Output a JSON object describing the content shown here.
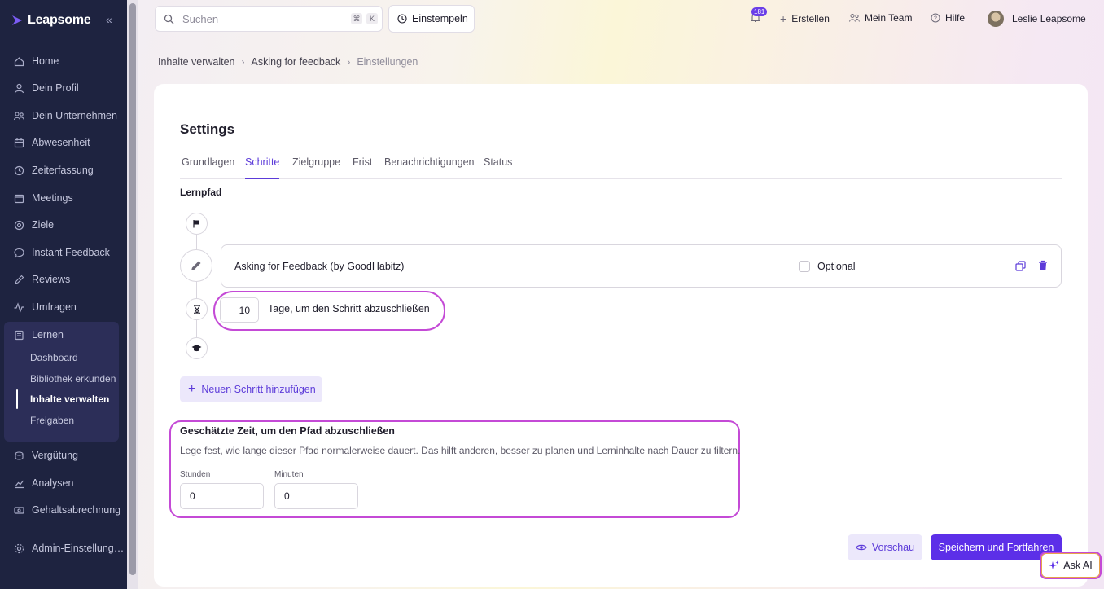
{
  "app": {
    "brand": "Leapsome",
    "collapse_glyph": "«"
  },
  "sidebar": {
    "items": [
      {
        "label": "Home",
        "icon": "home-icon"
      },
      {
        "label": "Dein Profil",
        "icon": "user-icon"
      },
      {
        "label": "Dein Unternehmen",
        "icon": "company-icon"
      },
      {
        "label": "Abwesenheit",
        "icon": "calendar-icon"
      },
      {
        "label": "Zeiterfassung",
        "icon": "clock-icon"
      },
      {
        "label": "Meetings",
        "icon": "meetings-icon"
      },
      {
        "label": "Ziele",
        "icon": "target-icon"
      },
      {
        "label": "Instant Feedback",
        "icon": "chat-icon"
      },
      {
        "label": "Reviews",
        "icon": "pen-icon"
      },
      {
        "label": "Umfragen",
        "icon": "pulse-icon"
      },
      {
        "label": "Lernen",
        "icon": "book-icon"
      },
      {
        "label": "Vergütung",
        "icon": "coins-icon"
      },
      {
        "label": "Analysen",
        "icon": "chart-icon"
      },
      {
        "label": "Gehaltsabrechnung",
        "icon": "payroll-icon"
      },
      {
        "label": "Admin-Einstellung…",
        "icon": "gear-icon"
      }
    ],
    "lernen_sub": [
      {
        "label": "Dashboard"
      },
      {
        "label": "Bibliothek erkunden"
      },
      {
        "label": "Inhalte verwalten"
      },
      {
        "label": "Freigaben"
      }
    ]
  },
  "topbar": {
    "search_placeholder": "Suchen",
    "shortcut_keys": [
      "⌘",
      "K"
    ],
    "einstempeln": "Einstempeln",
    "notification_count": "181",
    "create": "Erstellen",
    "team": "Mein Team",
    "help": "Hilfe",
    "user_name": "Leslie Leapsome"
  },
  "breadcrumb": {
    "items": [
      "Inhalte verwalten",
      "Asking for feedback",
      "Einstellungen"
    ]
  },
  "settings": {
    "title": "Settings",
    "tabs": [
      "Grundlagen",
      "Schritte",
      "Zielgruppe",
      "Frist",
      "Benachrichtigungen",
      "Status"
    ],
    "active_tab": "Schritte",
    "section_label": "Lernpfad",
    "step": {
      "title": "Asking for Feedback (by GoodHabitz)",
      "optional_label": "Optional",
      "optional_checked": false,
      "days_value": "10",
      "days_label": "Tage, um den Schritt abzuschließen"
    },
    "add_step": "Neuen Schritt hinzufügen",
    "estimated_time": {
      "title": "Geschätzte Zeit, um den Pfad abzuschließen",
      "description": "Lege fest, wie lange dieser Pfad normalerweise dauert. Das hilft anderen, besser zu planen und Lerninhalte nach Dauer zu filtern.",
      "hours_label": "Stunden",
      "hours_value": "0",
      "minutes_label": "Minuten",
      "minutes_value": "0"
    },
    "preview_button": "Vorschau",
    "save_button": "Speichern und Fortfahren"
  },
  "ask_ai": "Ask AI",
  "colors": {
    "sidebar_bg": "#1e2340",
    "accent": "#5c3bd9",
    "highlight": "#c44ad6"
  }
}
